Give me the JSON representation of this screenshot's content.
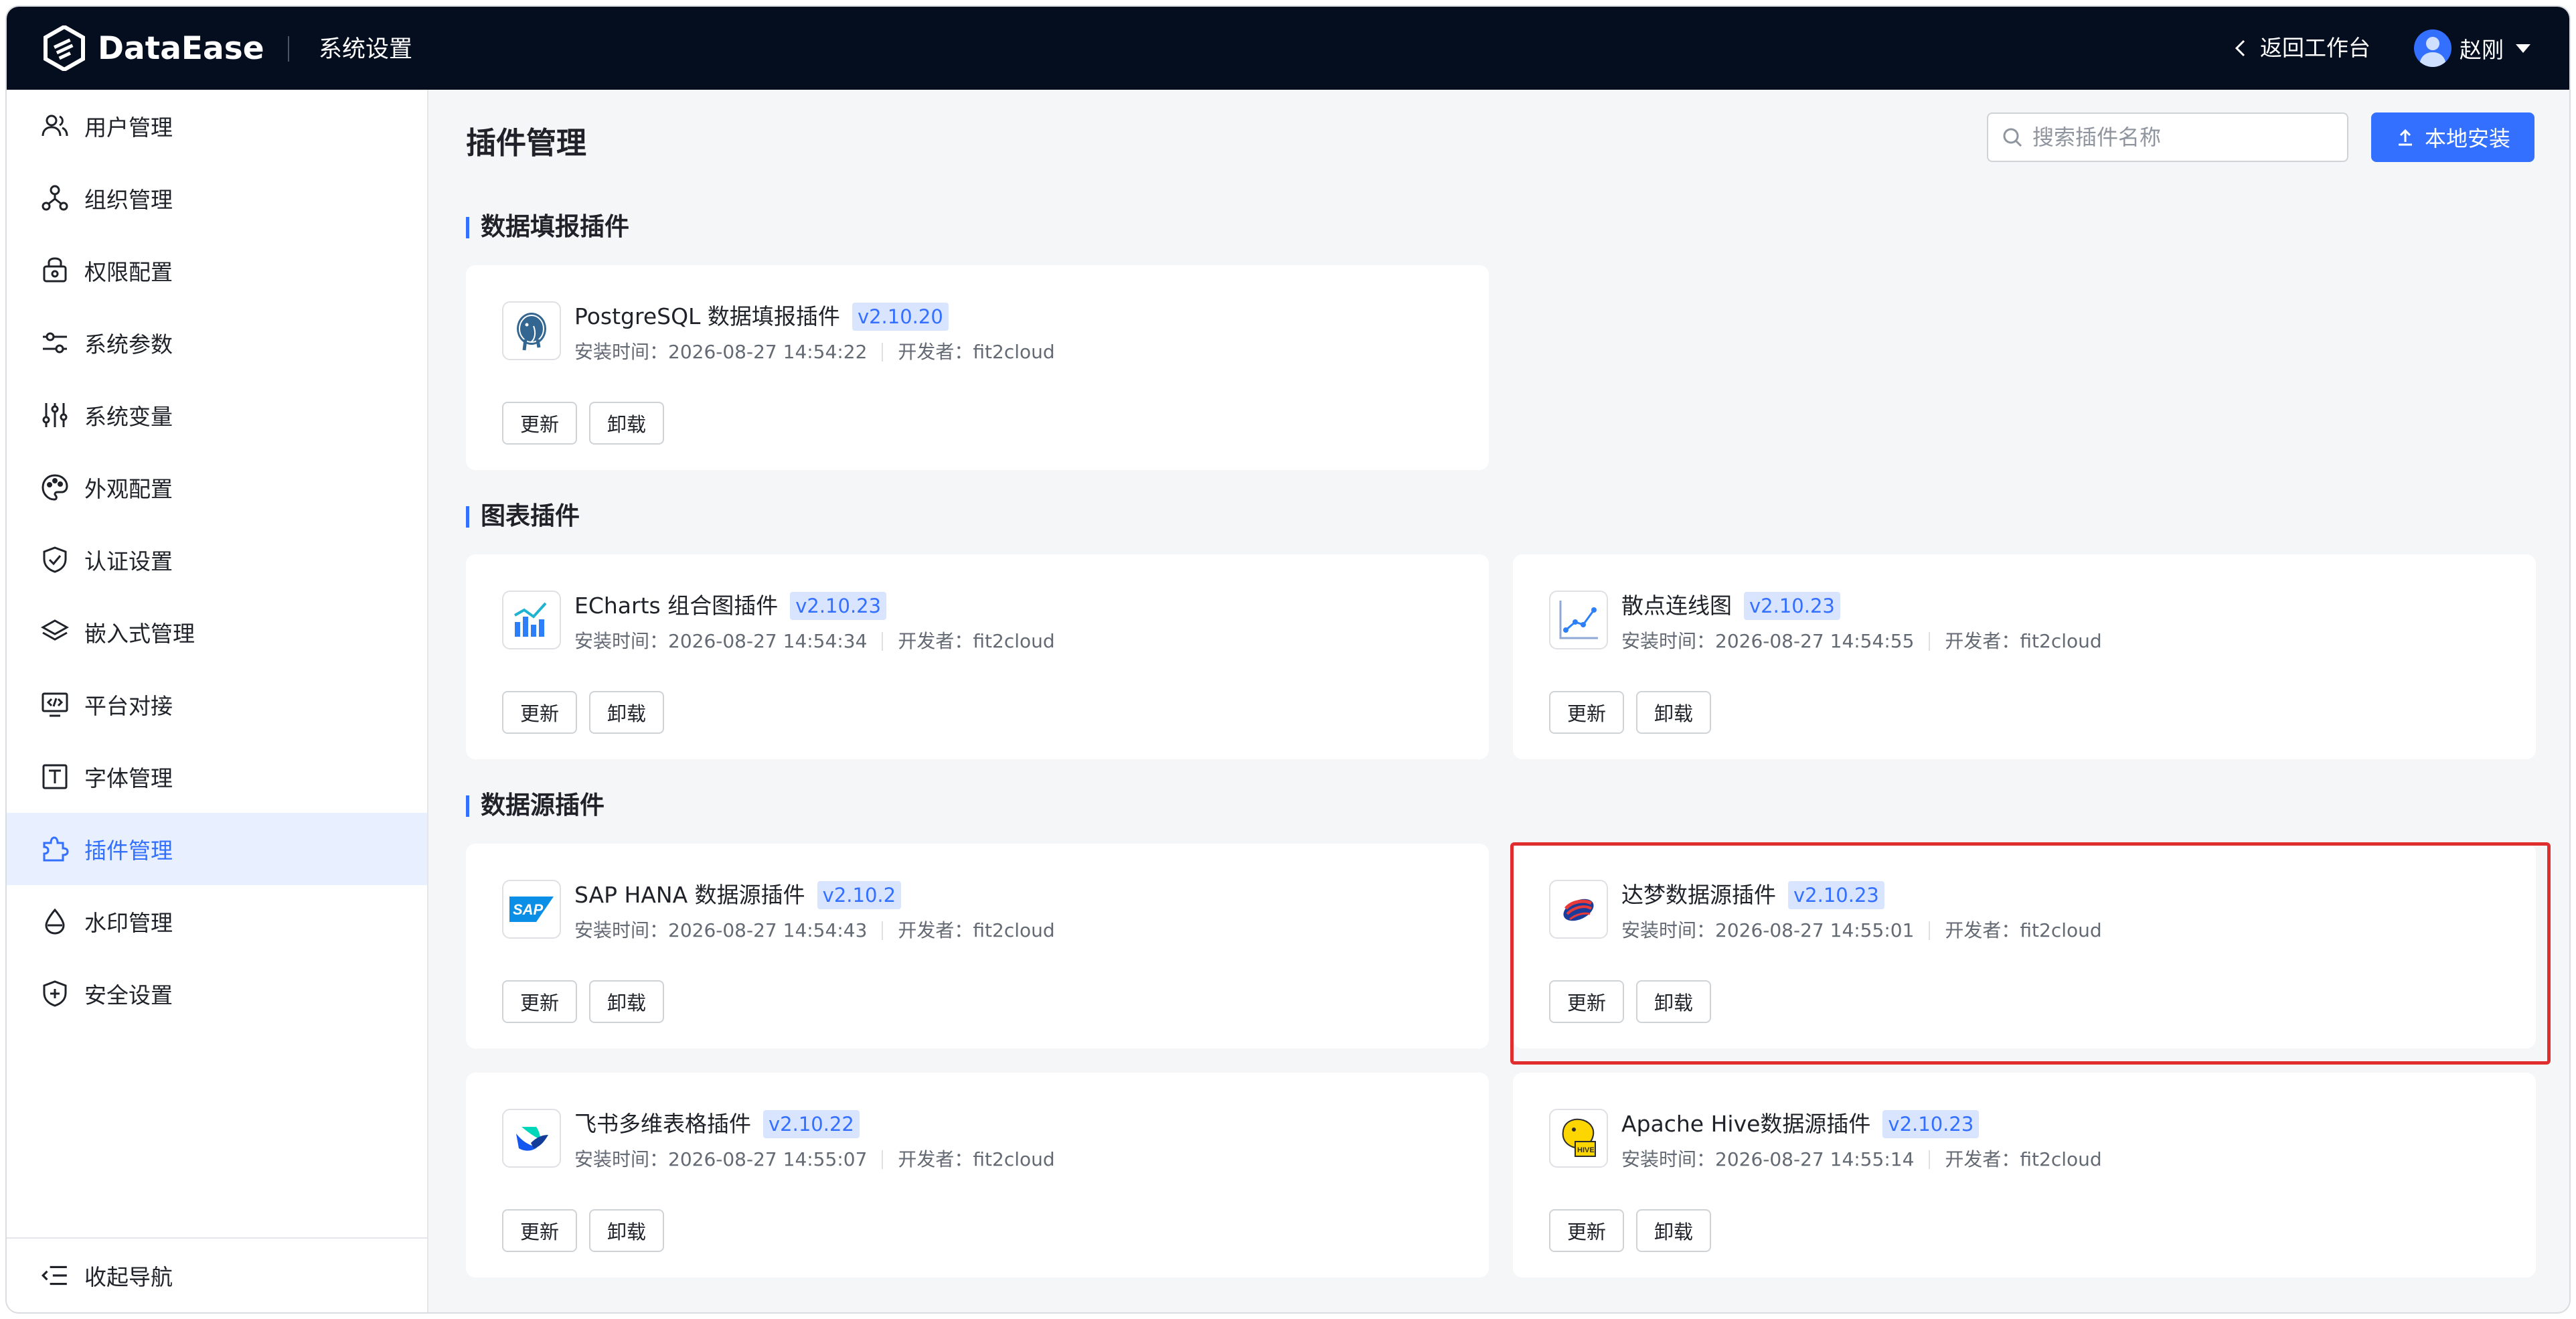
{
  "topbar": {
    "brand": "DataEase",
    "section_title": "系统设置",
    "back_label": "返回工作台",
    "user_name": "赵刚"
  },
  "sidebar": {
    "items": [
      {
        "label": "用户管理",
        "icon": "users-icon"
      },
      {
        "label": "组织管理",
        "icon": "org-tree-icon"
      },
      {
        "label": "权限配置",
        "icon": "lock-icon"
      },
      {
        "label": "系统参数",
        "icon": "sliders-icon"
      },
      {
        "label": "系统变量",
        "icon": "variables-icon"
      },
      {
        "label": "外观配置",
        "icon": "palette-icon"
      },
      {
        "label": "认证设置",
        "icon": "shield-check-icon"
      },
      {
        "label": "嵌入式管理",
        "icon": "layers-icon"
      },
      {
        "label": "平台对接",
        "icon": "code-monitor-icon"
      },
      {
        "label": "字体管理",
        "icon": "font-icon"
      },
      {
        "label": "插件管理",
        "icon": "puzzle-icon",
        "active": true
      },
      {
        "label": "水印管理",
        "icon": "droplet-icon"
      },
      {
        "label": "安全设置",
        "icon": "shield-plus-icon"
      }
    ],
    "collapse_label": "收起导航"
  },
  "main": {
    "page_title": "插件管理",
    "search_placeholder": "搜索插件名称",
    "install_label": "本地安装",
    "sections": [
      {
        "title": "数据填报插件",
        "plugins": [
          {
            "name": "PostgreSQL 数据填报插件",
            "version": "v2.10.20",
            "install_time": "安装时间：2026-08-27 14:54:22",
            "developer": "开发者：fit2cloud",
            "icon": "postgresql-icon"
          }
        ]
      },
      {
        "title": "图表插件",
        "plugins": [
          {
            "name": "ECharts 组合图插件",
            "version": "v2.10.23",
            "install_time": "安装时间：2026-08-27 14:54:34",
            "developer": "开发者：fit2cloud",
            "icon": "echarts-icon"
          },
          {
            "name": "散点连线图",
            "version": "v2.10.23",
            "install_time": "安装时间：2026-08-27 14:54:55",
            "developer": "开发者：fit2cloud",
            "icon": "scatter-line-icon"
          }
        ]
      },
      {
        "title": "数据源插件",
        "plugins": [
          {
            "name": "SAP HANA 数据源插件",
            "version": "v2.10.2",
            "install_time": "安装时间：2026-08-27 14:54:43",
            "developer": "开发者：fit2cloud",
            "icon": "sap-icon"
          },
          {
            "name": "达梦数据源插件",
            "version": "v2.10.23",
            "install_time": "安装时间：2026-08-27 14:55:01",
            "developer": "开发者：fit2cloud",
            "icon": "dameng-icon"
          },
          {
            "name": "飞书多维表格插件",
            "version": "v2.10.22",
            "install_time": "安装时间：2026-08-27 14:55:07",
            "developer": "开发者：fit2cloud",
            "icon": "feishu-icon"
          },
          {
            "name": "Apache Hive数据源插件",
            "version": "v2.10.23",
            "install_time": "安装时间：2026-08-27 14:55:14",
            "developer": "开发者：fit2cloud",
            "icon": "hive-icon"
          }
        ]
      }
    ],
    "update_label": "更新",
    "uninstall_label": "卸载"
  },
  "colors": {
    "topbar_bg": "#050e1f",
    "accent": "#3370ff",
    "highlight": "#e02d2d"
  }
}
